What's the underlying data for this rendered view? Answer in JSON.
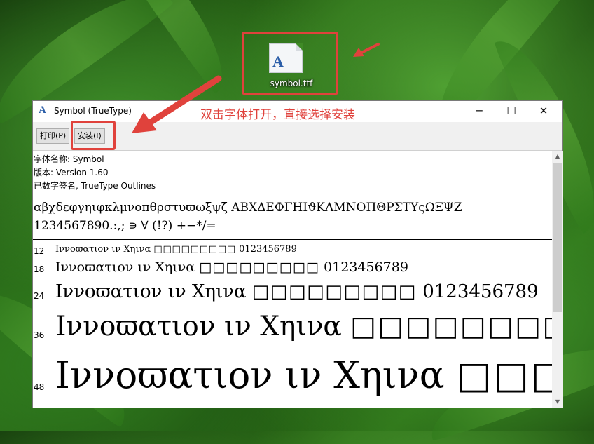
{
  "desktop": {
    "file_icon_glyph": "A",
    "file_icon_name": "font-file-icon",
    "file_name": "symbol.ttf"
  },
  "annotation": {
    "text": "双击字体打开，直接选择安装",
    "color": "#e0423c"
  },
  "window": {
    "title": "Symbol (TrueType)",
    "title_icon": "A",
    "controls": {
      "minimize": "─",
      "maximize": "☐",
      "close": "✕"
    },
    "toolbar": {
      "print_label": "打印(P)",
      "install_label": "安装(I)"
    }
  },
  "font_info": {
    "name_line": "字体名称: Symbol",
    "version_line": "版本: Version 1.60",
    "signature_line": "已数字签名, TrueType Outlines"
  },
  "charset": {
    "line1": "αβχδεφγηιφκλμνοπθρστυϖωξψζ ΑΒΧΔΕΦΓΗΙϑΚΛΜΝΟΠΘΡΣΤΥςΩΞΨΖ",
    "line2": "1234567890.:,; ∍ ∀ (!?) +−*/="
  },
  "samples": [
    {
      "size": "12",
      "text": "Ιννοϖατιον ιν Χηινα",
      "boxes": "□□□□□□□□□",
      "digits": "0123456789"
    },
    {
      "size": "18",
      "text": "Ιννοϖατιον ιν Χηινα",
      "boxes": "□□□□□□□□□",
      "digits": "0123456789"
    },
    {
      "size": "24",
      "text": "Ιννοϖατιον ιν Χηινα",
      "boxes": "□□□□□□□□□",
      "digits": "0123456789"
    },
    {
      "size": "36",
      "text": "Ιννοϖατιον ιν Χηινα",
      "boxes": "□□□□□□□□□",
      "digits": ""
    },
    {
      "size": "48",
      "text": "Ιννοϖατιον ιν Χηινα",
      "boxes": "□□□",
      "digits": ""
    }
  ],
  "scrollbar": {
    "up": "▲",
    "down": "▼"
  }
}
